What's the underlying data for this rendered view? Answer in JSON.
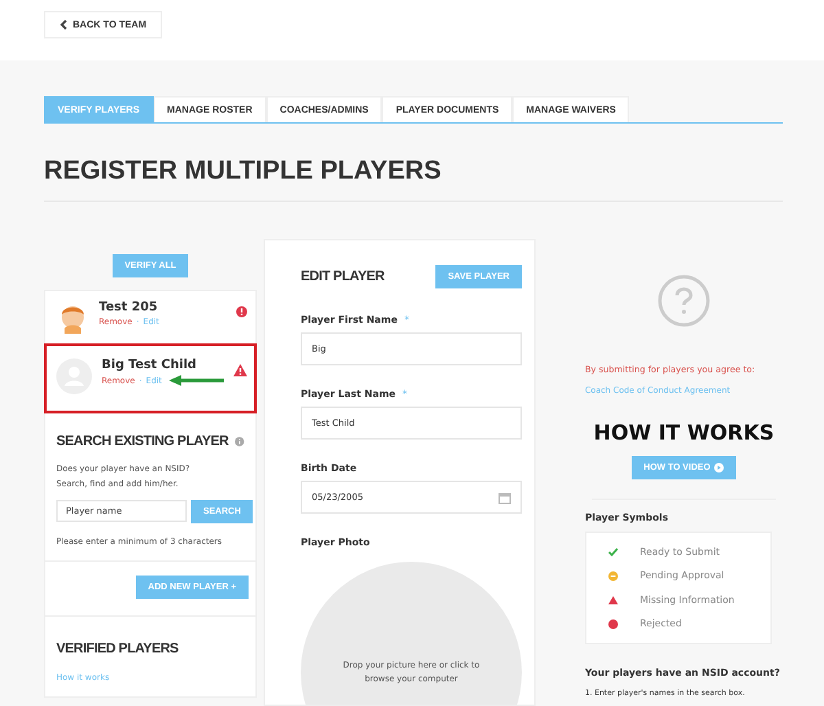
{
  "back_button": {
    "label": "BACK TO TEAM"
  },
  "tabs": [
    {
      "label": "VERIFY PLAYERS",
      "selected": true
    },
    {
      "label": "MANAGE ROSTER",
      "selected": false
    },
    {
      "label": "COACHES/ADMINS",
      "selected": false
    },
    {
      "label": "PLAYER DOCUMENTS",
      "selected": false
    },
    {
      "label": "MANAGE WAIVERS",
      "selected": false
    }
  ],
  "page_title": "REGISTER MULTIPLE PLAYERS",
  "verify_all_button": "VERIFY ALL",
  "players": [
    {
      "name": "Test 205",
      "avatar": {
        "kind": "cartoon"
      },
      "status": {
        "kind": "rejected"
      },
      "remove": "Remove",
      "separator": "·",
      "edit": "Edit",
      "highlighted": false
    },
    {
      "name": "Big Test Child",
      "avatar": {
        "kind": "placeholder"
      },
      "status": {
        "kind": "missing"
      },
      "remove": "Remove",
      "separator": "·",
      "edit": "Edit",
      "highlighted": true
    }
  ],
  "search": {
    "title": "SEARCH EXISTING PLAYER",
    "description": "Does your player have an NSID? Search, find and add him/her.",
    "placeholder": "Player name",
    "button": "SEARCH",
    "hint": "Please enter a minimum of 3 characters"
  },
  "add_new_player_button": "ADD NEW PLAYER +",
  "verified": {
    "title": "VERIFIED PLAYERS",
    "link": "How it works"
  },
  "edit_player": {
    "title": "EDIT PLAYER",
    "save_button": "SAVE PLAYER",
    "fields": [
      {
        "label": "Player First Name",
        "required_mark": "*",
        "value": "Big",
        "kind": "text"
      },
      {
        "label": "Player Last Name",
        "required_mark": "*",
        "value": "Test Child",
        "kind": "text"
      },
      {
        "label": "Birth Date",
        "value": "05/23/2005",
        "kind": "date"
      }
    ],
    "photo_label": "Player Photo",
    "photo_drop": "Drop your picture here or click to browse your computer"
  },
  "info": {
    "agree_text": "By submitting for players you agree to:",
    "agreement_link": "Coach Code of Conduct Agreement",
    "how_title": "HOW IT WORKS",
    "video_button": "HOW TO VIDEO",
    "symbols_title": "Player Symbols",
    "symbols": [
      {
        "kind": "ready",
        "label": "Ready to Submit"
      },
      {
        "kind": "pending",
        "label": "Pending Approval"
      },
      {
        "kind": "missing",
        "label": "Missing Information"
      },
      {
        "kind": "rejected",
        "label": "Rejected"
      }
    ],
    "nsid_title": "Your players have an NSID account?",
    "nsid_step": "1. Enter player's names in the search box."
  }
}
